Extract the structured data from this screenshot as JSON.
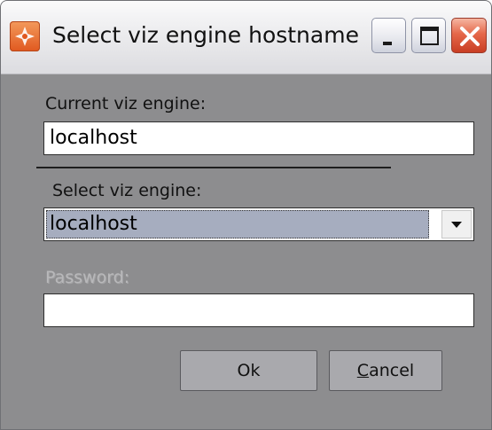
{
  "window": {
    "title": "Select viz engine hostname"
  },
  "titlebar_buttons": {
    "minimize": "minimize-icon",
    "maximize": "maximize-icon",
    "close": "close-icon"
  },
  "form": {
    "current_label": "Current viz engine:",
    "current_value": "localhost",
    "select_label": "Select viz engine:",
    "select_value": "localhost",
    "password_label": "Password:",
    "password_value": ""
  },
  "buttons": {
    "ok_label": "Ok",
    "cancel_label": "Cancel"
  },
  "colors": {
    "client_background": "#8d8d8f",
    "selection_highlight": "#a6adbf",
    "close_button": "#e5684a"
  }
}
